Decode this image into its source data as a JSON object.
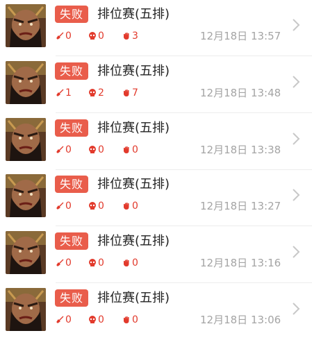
{
  "colors": {
    "badge_bg": "#e95d4b",
    "stat_red": "#e23a2c",
    "time_gray": "#a4a4a4",
    "chevron_gray": "#c8c8c8"
  },
  "icons": {
    "kills": "sword-icon",
    "deaths": "skull-icon",
    "assists": "hand-icon",
    "arrow": "chevron-right-icon"
  },
  "matches": [
    {
      "result": "失败",
      "mode": "排位赛(五排)",
      "kills": "0",
      "deaths": "0",
      "assists": "3",
      "time": "12月18日 13:57"
    },
    {
      "result": "失败",
      "mode": "排位赛(五排)",
      "kills": "1",
      "deaths": "2",
      "assists": "7",
      "time": "12月18日 13:48"
    },
    {
      "result": "失败",
      "mode": "排位赛(五排)",
      "kills": "0",
      "deaths": "0",
      "assists": "0",
      "time": "12月18日 13:38"
    },
    {
      "result": "失败",
      "mode": "排位赛(五排)",
      "kills": "0",
      "deaths": "0",
      "assists": "0",
      "time": "12月18日 13:27"
    },
    {
      "result": "失败",
      "mode": "排位赛(五排)",
      "kills": "0",
      "deaths": "0",
      "assists": "0",
      "time": "12月18日 13:16"
    },
    {
      "result": "失败",
      "mode": "排位赛(五排)",
      "kills": "0",
      "deaths": "0",
      "assists": "0",
      "time": "12月18日 13:06"
    }
  ]
}
